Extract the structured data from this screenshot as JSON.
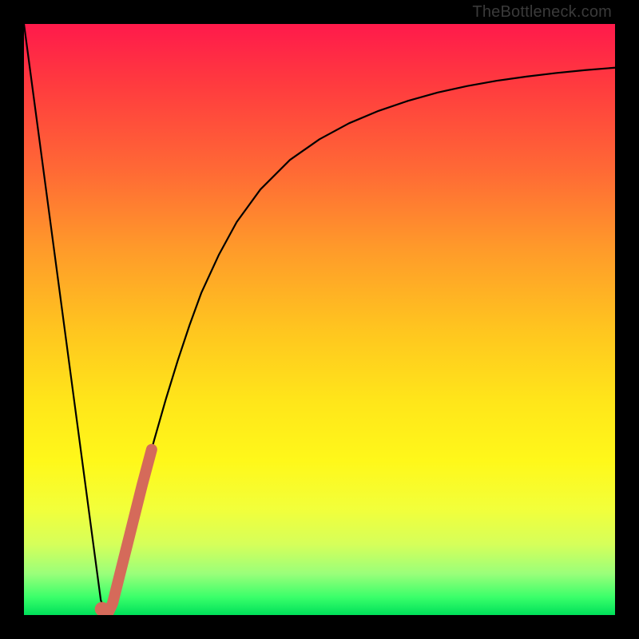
{
  "watermark": "TheBottleneck.com",
  "chart_data": {
    "type": "line",
    "title": "",
    "xlabel": "",
    "ylabel": "",
    "xlim": [
      0,
      100
    ],
    "ylim": [
      0,
      100
    ],
    "grid": false,
    "legend": false,
    "annotations": [],
    "series": [
      {
        "name": "bottleneck-curve",
        "color": "#000000",
        "x": [
          0.0,
          2.0,
          4.0,
          6.0,
          8.0,
          10.0,
          12.0,
          13.0,
          14.0,
          15.0,
          16.0,
          18.0,
          20.0,
          22.0,
          24.0,
          26.0,
          28.0,
          30.0,
          33.0,
          36.0,
          40.0,
          45.0,
          50.0,
          55.0,
          60.0,
          65.0,
          70.0,
          75.0,
          80.0,
          85.0,
          90.0,
          95.0,
          100.0
        ],
        "values": [
          100,
          85.0,
          70.0,
          55.0,
          40.0,
          25.0,
          10.0,
          2.5,
          0.0,
          2.0,
          6.0,
          14.0,
          22.0,
          29.5,
          36.5,
          43.0,
          49.0,
          54.5,
          61.0,
          66.5,
          72.0,
          77.0,
          80.5,
          83.2,
          85.3,
          87.0,
          88.4,
          89.5,
          90.4,
          91.1,
          91.7,
          92.2,
          92.6
        ]
      },
      {
        "name": "highlight-segment",
        "color": "#d56a5a",
        "x": [
          14.3,
          15.0,
          16.0,
          17.0,
          18.0,
          19.0,
          20.0,
          21.6
        ],
        "values": [
          0.5,
          2.0,
          6.0,
          10.0,
          14.0,
          18.0,
          22.0,
          28.0
        ]
      },
      {
        "name": "highlight-dot",
        "color": "#d56a5a",
        "x": [
          13.2
        ],
        "values": [
          1.0
        ]
      }
    ]
  },
  "colors": {
    "frame": "#000000",
    "curve": "#000000",
    "highlight": "#d56a5a"
  }
}
